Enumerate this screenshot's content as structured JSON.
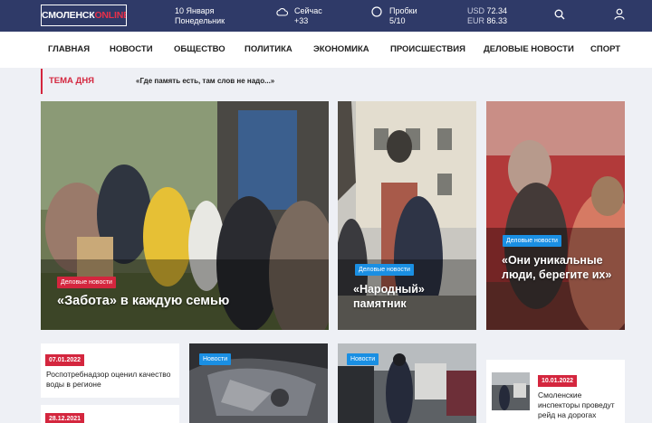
{
  "logo": {
    "part1": "СМОЛЕНСК",
    "part2": "ONLINE"
  },
  "date": {
    "day": "10 Января",
    "weekday": "Понедельник"
  },
  "weather": {
    "label": "Сейчас",
    "value": "+33",
    "icon": "cloud-icon"
  },
  "traffic": {
    "label": "Пробки",
    "value": "5/10",
    "icon": "circle-icon"
  },
  "fx": {
    "usd_label": "USD",
    "usd": "72.34",
    "eur_label": "EUR",
    "eur": "86.33"
  },
  "nav": [
    "ГЛАВНАЯ",
    "НОВОСТИ",
    "ОБЩЕСТВО",
    "ПОЛИТИКА",
    "ЭКОНОМИКА",
    "ПРОИСШЕСТВИЯ",
    "ДЕЛОВЫЕ НОВОСТИ",
    "СПОРТ"
  ],
  "topic": {
    "label": "ТЕМА ДНЯ",
    "text": "«Где память есть, там слов не надо...»"
  },
  "featured": [
    {
      "tag": "Деловые новости",
      "title": "«Забота» в каждую семью"
    },
    {
      "tag": "Деловые новости",
      "title": "«Народный» памятник"
    },
    {
      "tag": "Деловые новости",
      "title": "«Они уникальные люди, берегите их»"
    }
  ],
  "news": [
    {
      "date": "07.01.2022",
      "text": "Роспотребнадзор оценил качество воды в регионе"
    },
    {
      "date": "28.12.2021",
      "text": ""
    }
  ],
  "photo_cards": [
    {
      "tag": "Новости"
    },
    {
      "tag": "Новости"
    }
  ],
  "side_news": {
    "date": "10.01.2022",
    "text": "Смоленские инспекторы проведут рейд на дорогах города"
  },
  "colors": {
    "topbar": "#2f3a68",
    "accent": "#d4263e",
    "tag": "#1a8fe3"
  }
}
